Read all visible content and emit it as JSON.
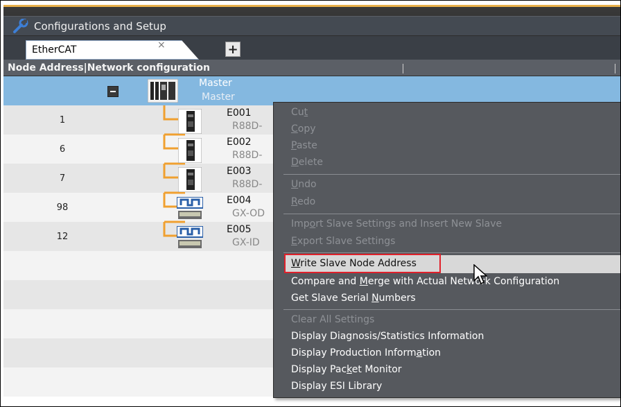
{
  "window": {
    "title": "Configurations and Setup"
  },
  "tab": {
    "label": "EtherCAT",
    "close": "×",
    "add": "+"
  },
  "columns": {
    "node_address": "Node Address",
    "network_configuration": "Network configuration"
  },
  "master": {
    "name": "Master",
    "model": "Master"
  },
  "slaves": [
    {
      "address": "1",
      "name": "E001",
      "model": "R88D-"
    },
    {
      "address": "6",
      "name": "E002",
      "model": "R88D-"
    },
    {
      "address": "7",
      "name": "E003",
      "model": "R88D-"
    },
    {
      "address": "98",
      "name": "E004",
      "model": "GX-OD"
    },
    {
      "address": "12",
      "name": "E005",
      "model": "GX-ID"
    }
  ],
  "context_menu": {
    "cut": {
      "pre": "Cu",
      "u": "t",
      "post": ""
    },
    "copy": {
      "pre": "",
      "u": "C",
      "post": "opy"
    },
    "paste": {
      "pre": "",
      "u": "P",
      "post": "aste"
    },
    "delete": {
      "pre": "",
      "u": "D",
      "post": "elete"
    },
    "undo": {
      "pre": "",
      "u": "U",
      "post": "ndo"
    },
    "redo": {
      "pre": "",
      "u": "R",
      "post": "edo"
    },
    "import": {
      "pre": "Imp",
      "u": "o",
      "post": "rt Slave Settings and Insert New Slave"
    },
    "export": {
      "pre": "",
      "u": "E",
      "post": "xport Slave Settings"
    },
    "write": {
      "pre": "",
      "u": "W",
      "post": "rite Slave Node Address"
    },
    "compare": {
      "pre": "Compare and ",
      "u": "M",
      "post": "erge with Actual Network Configuration"
    },
    "serial": {
      "pre": "Get Slave Serial ",
      "u": "N",
      "post": "umbers"
    },
    "clear": {
      "pre": "Clear All Settings",
      "u": "",
      "post": ""
    },
    "diag": {
      "pre": "Display Diagnosis/Statistics Information",
      "u": "",
      "post": ""
    },
    "prod": {
      "pre": "Display Production Inform",
      "u": "a",
      "post": "tion"
    },
    "packet": {
      "pre": "Display Pac",
      "u": "k",
      "post": "et Monitor"
    },
    "esi": {
      "pre": "Display ESI Library",
      "u": "",
      "post": ""
    }
  },
  "colors": {
    "accent_orange": "#e8b04a",
    "selection_blue": "#84b8e0",
    "menu_bg": "#56595e",
    "highlight_red": "#e0202a"
  }
}
